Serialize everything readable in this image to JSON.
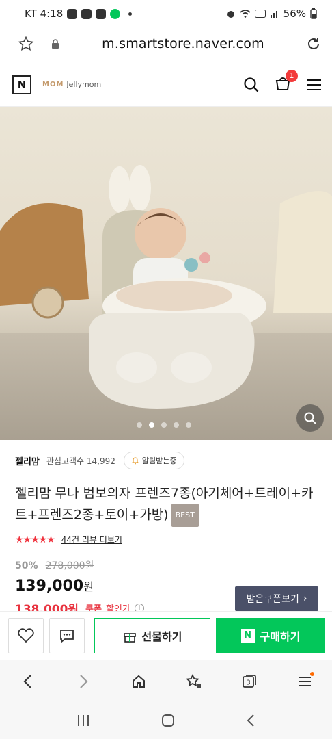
{
  "status": {
    "carrier_time": "KT 4:18",
    "battery": "56%"
  },
  "browser": {
    "url": "m.smartstore.naver.com"
  },
  "header": {
    "brand_name": "Jellymom",
    "brand_mark": "MOM",
    "cart_count": "1"
  },
  "hero": {
    "slide_count": 5,
    "active_slide": 1
  },
  "store": {
    "name": "젤리맘",
    "followers_label": "관심고객수 14,992",
    "alarm_label": "알림받는중"
  },
  "product": {
    "title": "젤리맘 무나 범보의자 프렌즈7종(아기체어+트레이+카트+프렌즈2종+토이+가방)",
    "badge": "BEST",
    "rating_value": 4.5,
    "reviews_label": "44건 리뷰 더보기"
  },
  "price": {
    "discount_rate": "50%",
    "original": "278,000원",
    "current": "139,000",
    "current_unit": "원",
    "coupon_price": "138,000원",
    "coupon_label": "쿠폰",
    "coupon_suffix": "할인가",
    "coupon_info": "i",
    "coupon_button": "받은쿠폰보기"
  },
  "actions": {
    "gift": "선물하기",
    "buy": "구매하기",
    "buy_icon_letter": "N"
  },
  "nav": {
    "tabs_count": "3"
  },
  "colors": {
    "naver_green": "#03c75a",
    "sale_red": "#e8333f",
    "coupon_btn": "#4a5068"
  }
}
